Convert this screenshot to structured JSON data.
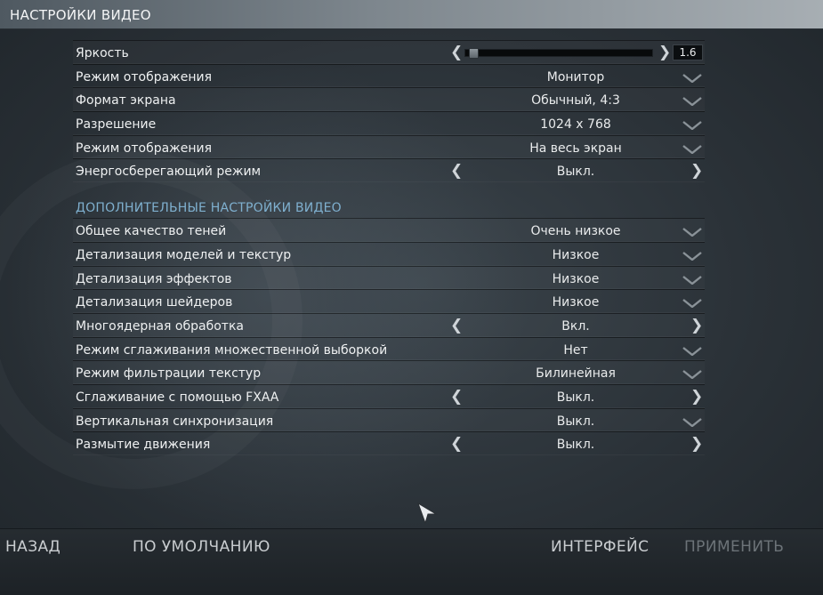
{
  "window": {
    "title": "НАСТРОЙКИ ВИДЕО"
  },
  "basic": [
    {
      "label": "Яркость",
      "kind": "slider",
      "slider_value": "1.6",
      "slider_fraction": 0.02
    },
    {
      "label": "Режим отображения",
      "kind": "dropdown",
      "value": "Монитор"
    },
    {
      "label": "Формат экрана",
      "kind": "dropdown",
      "value": "Обычный, 4:3"
    },
    {
      "label": "Разрешение",
      "kind": "dropdown",
      "value": "1024 x 768"
    },
    {
      "label": "Режим отображения",
      "kind": "dropdown",
      "value": "На весь экран"
    },
    {
      "label": "Энергосберегающий режим",
      "kind": "toggle",
      "value": "Выкл."
    }
  ],
  "advanced": {
    "header": "ДОПОЛНИТЕЛЬНЫЕ НАСТРОЙКИ ВИДЕО",
    "rows": [
      {
        "label": "Общее качество теней",
        "kind": "dropdown",
        "value": "Очень низкое"
      },
      {
        "label": "Детализация моделей и текстур",
        "kind": "dropdown",
        "value": "Низкое"
      },
      {
        "label": "Детализация эффектов",
        "kind": "dropdown",
        "value": "Низкое"
      },
      {
        "label": "Детализация шейдеров",
        "kind": "dropdown",
        "value": "Низкое"
      },
      {
        "label": "Многоядерная обработка",
        "kind": "toggle",
        "value": "Вкл."
      },
      {
        "label": "Режим сглаживания множественной выборкой",
        "kind": "dropdown",
        "value": "Нет"
      },
      {
        "label": "Режим фильтрации текстур",
        "kind": "dropdown",
        "value": "Билинейная"
      },
      {
        "label": "Сглаживание с помощью FXAA",
        "kind": "toggle",
        "value": "Выкл."
      },
      {
        "label": "Вертикальная синхронизация",
        "kind": "dropdown",
        "value": "Выкл."
      },
      {
        "label": "Размытие движения",
        "kind": "toggle",
        "value": "Выкл."
      }
    ]
  },
  "footer": {
    "back": "НАЗАД",
    "defaults": "ПО УМОЛЧАНИЮ",
    "interface": "ИНТЕРФЕЙС",
    "apply": "ПРИМЕНИТЬ"
  },
  "icons": {
    "arrow_left": "left-chevron-icon",
    "arrow_right": "right-chevron-icon",
    "dropdown": "chevron-down-icon",
    "cursor": "mouse-cursor-icon"
  },
  "colors": {
    "section_header": "#7fb0cf",
    "apply_disabled": "#6c7378"
  }
}
